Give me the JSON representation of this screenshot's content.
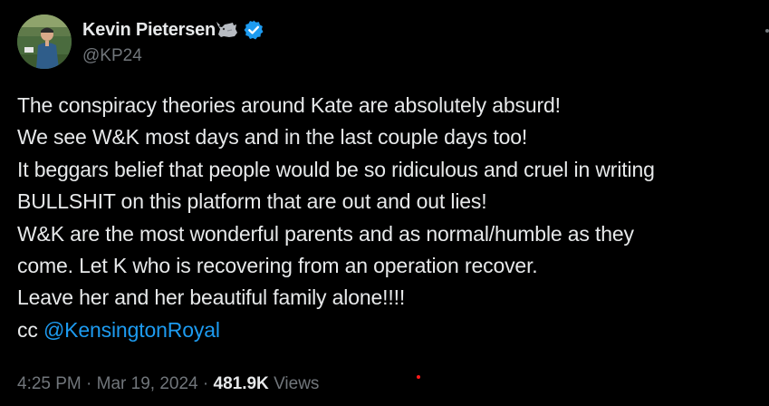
{
  "author": {
    "display_name": "Kevin Pietersen",
    "handle": "@KP24",
    "avatar_icon": "avatar-photo",
    "badge_icons": [
      "rhino-emoji-icon",
      "verified-badge-icon"
    ],
    "verified_color": "#1d9bf0"
  },
  "tweet": {
    "lines": [
      "The conspiracy theories around Kate are absolutely absurd!",
      "We see W&K most days and in the last couple days too!",
      "It beggars belief that people would be so ridiculous and cruel in writing",
      "BULLSHIT on this platform that are out and out lies!",
      "W&K are the most wonderful parents and as normal/humble as they",
      "come. Let K who is recovering from an operation recover.",
      "Leave her and her beautiful family alone!!!!"
    ],
    "cc_prefix": "cc ",
    "mention": "@KensingtonRoyal"
  },
  "meta": {
    "time": "4:25 PM",
    "separator": " · ",
    "date": "Mar 19, 2024",
    "views_count": "481.9K",
    "views_label": " Views"
  },
  "colors": {
    "background": "#000000",
    "text": "#e7e9ea",
    "secondary_text": "#71767b",
    "link": "#1d9bf0"
  }
}
